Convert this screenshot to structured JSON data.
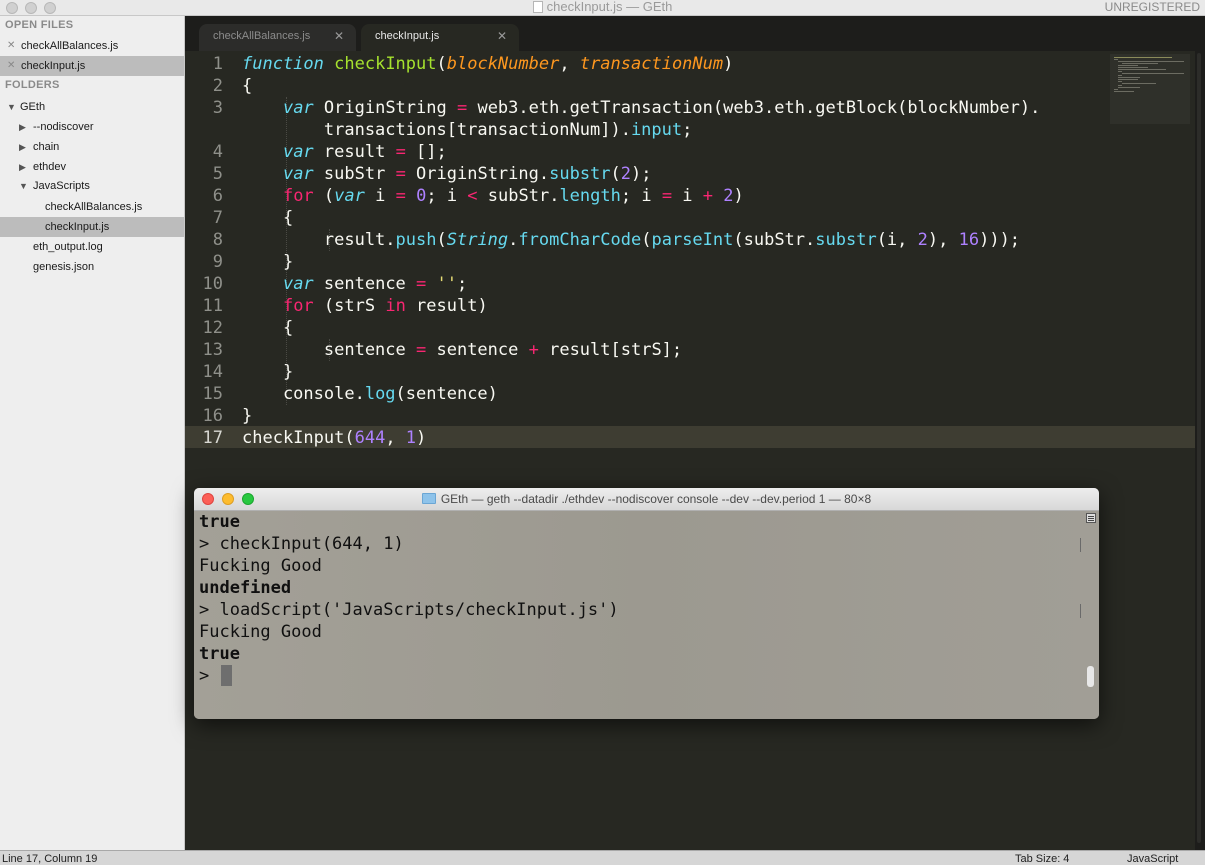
{
  "window": {
    "title": "checkInput.js — GEth",
    "registration": "UNREGISTERED"
  },
  "sidebar": {
    "open_files_header": "OPEN FILES",
    "open_files": [
      {
        "label": "checkAllBalances.js",
        "selected": false
      },
      {
        "label": "checkInput.js",
        "selected": true
      }
    ],
    "folders_header": "FOLDERS",
    "tree": [
      {
        "label": "GEth",
        "expanded": true
      },
      {
        "label": "--nodiscover",
        "expanded": false
      },
      {
        "label": "chain",
        "expanded": false
      },
      {
        "label": "ethdev",
        "expanded": false
      },
      {
        "label": "JavaScripts",
        "expanded": true
      },
      {
        "label": "checkAllBalances.js"
      },
      {
        "label": "checkInput.js",
        "selected": true
      },
      {
        "label": "eth_output.log"
      },
      {
        "label": "genesis.json"
      }
    ]
  },
  "tabs": [
    {
      "label": "checkAllBalances.js",
      "active": false
    },
    {
      "label": "checkInput.js",
      "active": true
    }
  ],
  "editor": {
    "line_numbers": [
      "1",
      "2",
      "3",
      "4",
      "5",
      "6",
      "7",
      "8",
      "9",
      "10",
      "11",
      "12",
      "13",
      "14",
      "15",
      "16",
      "17"
    ],
    "current_line": "17",
    "theme_colors": {
      "background": "#272822",
      "keyword": "#66d9ef",
      "function": "#a6e22e",
      "parameter": "#fd971f",
      "operator": "#f92672",
      "number": "#ae81ff",
      "string": "#e6db74"
    }
  },
  "terminal": {
    "title": "GEth — geth --datadir ./ethdev --nodiscover console --dev --dev.period 1 — 80×8",
    "lines": [
      {
        "text": "true",
        "bold": true
      },
      {
        "text": "> checkInput(644, 1)",
        "bold": false
      },
      {
        "text": "Fucking Good",
        "bold": false
      },
      {
        "text": "undefined",
        "bold": true
      },
      {
        "text": "> loadScript('JavaScripts/checkInput.js')",
        "bold": false
      },
      {
        "text": "Fucking Good",
        "bold": false
      },
      {
        "text": "true",
        "bold": true
      },
      {
        "text": "> ",
        "bold": false
      }
    ]
  },
  "statusbar": {
    "position": "Line 17, Column 19",
    "tab_size": "Tab Size: 4",
    "syntax": "JavaScript"
  }
}
